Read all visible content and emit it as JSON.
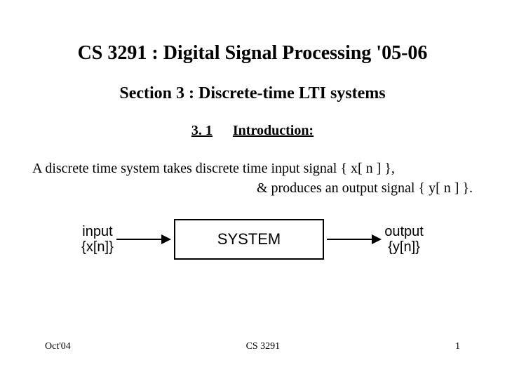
{
  "title": "CS 3291 :  Digital Signal Processing '05-06",
  "subtitle": "Section 3 : Discrete-time LTI systems",
  "section": {
    "number": "3. 1",
    "label": "Introduction:"
  },
  "body_line1": "A discrete time system takes discrete time input signal { x[ n ] },",
  "body_line2": "& produces an output signal { y[ n ] }.",
  "diagram": {
    "input_top": "input",
    "input_bottom": "{x[n]}",
    "box": "SYSTEM",
    "output_top": "output",
    "output_bottom": "{y[n]}"
  },
  "footer": {
    "left": "Oct'04",
    "center": "CS 3291",
    "right": "1"
  }
}
